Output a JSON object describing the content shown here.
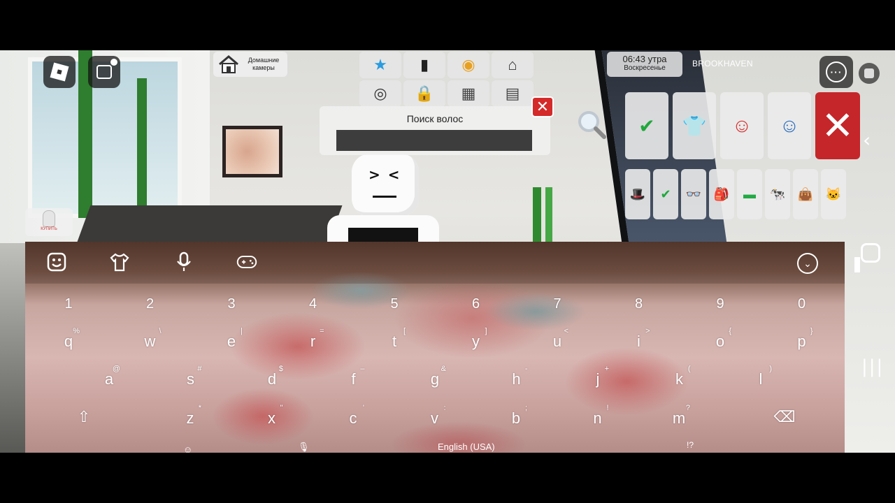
{
  "hud": {
    "home_cams_label": "Домашние камеры",
    "clock_time": "06:43 утра",
    "clock_day": "Воскресенье",
    "game_name": "BROOKHAVEN",
    "buy_label": "КУПИТЬ"
  },
  "tools": [
    {
      "name": "star-icon",
      "glyph": "★",
      "color": "#2a9be0"
    },
    {
      "name": "speaker-icon",
      "glyph": "▮",
      "color": "#222"
    },
    {
      "name": "color-wheel-icon",
      "glyph": "◉",
      "color": "#e8a020"
    },
    {
      "name": "house-icon",
      "glyph": "⌂",
      "color": "#333"
    },
    {
      "name": "camera-icon",
      "glyph": "◎",
      "color": "#333"
    },
    {
      "name": "lock-icon",
      "glyph": "🔒",
      "color": "#2a2"
    },
    {
      "name": "grid-icon",
      "glyph": "▦",
      "color": "#444"
    },
    {
      "name": "notepad-icon",
      "glyph": "▤",
      "color": "#444"
    }
  ],
  "search": {
    "title": "Поиск волос",
    "value": ""
  },
  "catalog": {
    "row1": [
      {
        "name": "hair-select-icon",
        "glyph": "✔",
        "color": "#1fa83b"
      },
      {
        "name": "shirt-icon",
        "glyph": "👕",
        "color": "#444"
      },
      {
        "name": "avatar-red-icon",
        "glyph": "☺",
        "color": "#d83030"
      },
      {
        "name": "avatar-blue-icon",
        "glyph": "☺",
        "color": "#2a6fc0"
      }
    ],
    "close_glyph": "✕",
    "row2": [
      {
        "name": "hat-icon",
        "glyph": "🎩",
        "color": "#2a6fd8"
      },
      {
        "name": "hair-check-icon",
        "glyph": "✔",
        "color": "#1fa83b"
      },
      {
        "name": "glasses-icon",
        "glyph": "👓",
        "color": "#111"
      },
      {
        "name": "backpack-icon",
        "glyph": "🎒",
        "color": "#a07850"
      },
      {
        "name": "fanny-pack-icon",
        "glyph": "▬",
        "color": "#22aa44"
      },
      {
        "name": "pet-cow-icon",
        "glyph": "🐄",
        "color": "#333"
      },
      {
        "name": "bag-icon",
        "glyph": "👜",
        "color": "#b02020"
      },
      {
        "name": "pet-cat-icon",
        "glyph": "🐱",
        "color": "#888"
      }
    ]
  },
  "keyboard": {
    "collapse_glyph": "⌄",
    "numbers": [
      "1",
      "2",
      "3",
      "4",
      "5",
      "6",
      "7",
      "8",
      "9",
      "0"
    ],
    "row1": [
      {
        "k": "q",
        "h": "%"
      },
      {
        "k": "w",
        "h": "\\"
      },
      {
        "k": "e",
        "h": "|"
      },
      {
        "k": "r",
        "h": "="
      },
      {
        "k": "t",
        "h": "["
      },
      {
        "k": "y",
        "h": "]"
      },
      {
        "k": "u",
        "h": "<"
      },
      {
        "k": "i",
        "h": ">"
      },
      {
        "k": "o",
        "h": "{"
      },
      {
        "k": "p",
        "h": "}"
      }
    ],
    "row2": [
      {
        "k": "a",
        "h": "@"
      },
      {
        "k": "s",
        "h": "#"
      },
      {
        "k": "d",
        "h": "$"
      },
      {
        "k": "f",
        "h": "–"
      },
      {
        "k": "g",
        "h": "&"
      },
      {
        "k": "h",
        "h": "-"
      },
      {
        "k": "j",
        "h": "+"
      },
      {
        "k": "k",
        "h": "("
      },
      {
        "k": "l",
        "h": ")"
      }
    ],
    "row3": [
      {
        "k": "z",
        "h": "*"
      },
      {
        "k": "x",
        "h": "\""
      },
      {
        "k": "c",
        "h": "'"
      },
      {
        "k": "v",
        "h": ":"
      },
      {
        "k": "b",
        "h": ";"
      },
      {
        "k": "n",
        "h": "!"
      },
      {
        "k": "m",
        "h": "?"
      }
    ],
    "shift_glyph": "⇧",
    "backspace_glyph": "⌫",
    "bottom_punct": "!?",
    "bottom_lang": "English (USA)"
  }
}
